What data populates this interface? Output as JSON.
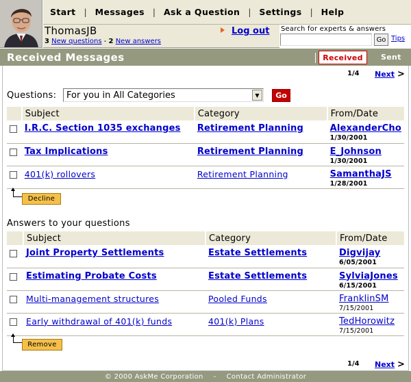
{
  "nav": {
    "items": [
      "Start",
      "Messages",
      "Ask a Question",
      "Settings",
      "Help"
    ]
  },
  "user": {
    "name": "ThomasJB",
    "new_questions_count": "3",
    "new_questions_label": "New questions",
    "separator": "-",
    "new_answers_count": "2",
    "new_answers_label": "New answers",
    "logout_label": "Log out"
  },
  "search": {
    "label": "Search for experts & answers",
    "value": "",
    "go_label": "Go",
    "tips_label": "Tips"
  },
  "page": {
    "title": "Received Messages",
    "tab_received": "Received",
    "tab_sent": "Sent",
    "pager_top": "1/4",
    "pager_bottom": "1/4",
    "next_label": "Next",
    "next_arrow": ">"
  },
  "questions_filter": {
    "label": "Questions:",
    "selected": "For you in All Categories",
    "go_label": "Go"
  },
  "questions": {
    "headers": [
      "Subject",
      "Category",
      "From/Date"
    ],
    "rows": [
      {
        "subject": "I.R.C. Section 1035 exchanges",
        "category": "Retirement Planning",
        "from": "AlexanderCho",
        "date": "1/30/2001",
        "unread": true
      },
      {
        "subject": "Tax Implications",
        "category": "Retirement Planning",
        "from": "E_Johnson",
        "date": "1/30/2001",
        "unread": true
      },
      {
        "subject": "401(k) rollovers",
        "category": "Retirement Planning",
        "from": "SamanthaJS",
        "date": "1/28/2001",
        "unread": false
      }
    ],
    "action_label": "Decline"
  },
  "answers": {
    "title": "Answers to your questions",
    "headers": [
      "Subject",
      "Category",
      "From/Date"
    ],
    "rows": [
      {
        "subject": "Joint Property Settlements",
        "category": "Estate Settlements",
        "from": "Digvijay",
        "date": "6/05/2001",
        "unread": true
      },
      {
        "subject": "Estimating Probate Costs",
        "category": "Estate Settlements",
        "from": "SylviaJones",
        "date": "6/15/2001",
        "unread": true
      },
      {
        "subject": "Multi-management structures",
        "category": "Pooled Funds",
        "from": "FranklinSM",
        "date": "7/15/2001",
        "unread": false
      },
      {
        "subject": "Early withdrawal of 401(k) funds",
        "category": "401(k) Plans",
        "from": "TedHorowitz",
        "date": "7/15/2001",
        "unread": false
      }
    ],
    "action_label": "Remove"
  },
  "footer": {
    "copyright": "© 2000 AskMe Corporation",
    "dash": "-",
    "contact": "Contact Administrator"
  },
  "colors": {
    "nav_bg": "#ece9d8",
    "title_bar": "#95997f",
    "link": "#0000cc",
    "accent_red": "#c30000",
    "button_yellow": "#f5c04a",
    "logout_arrow": "#e6651a"
  }
}
